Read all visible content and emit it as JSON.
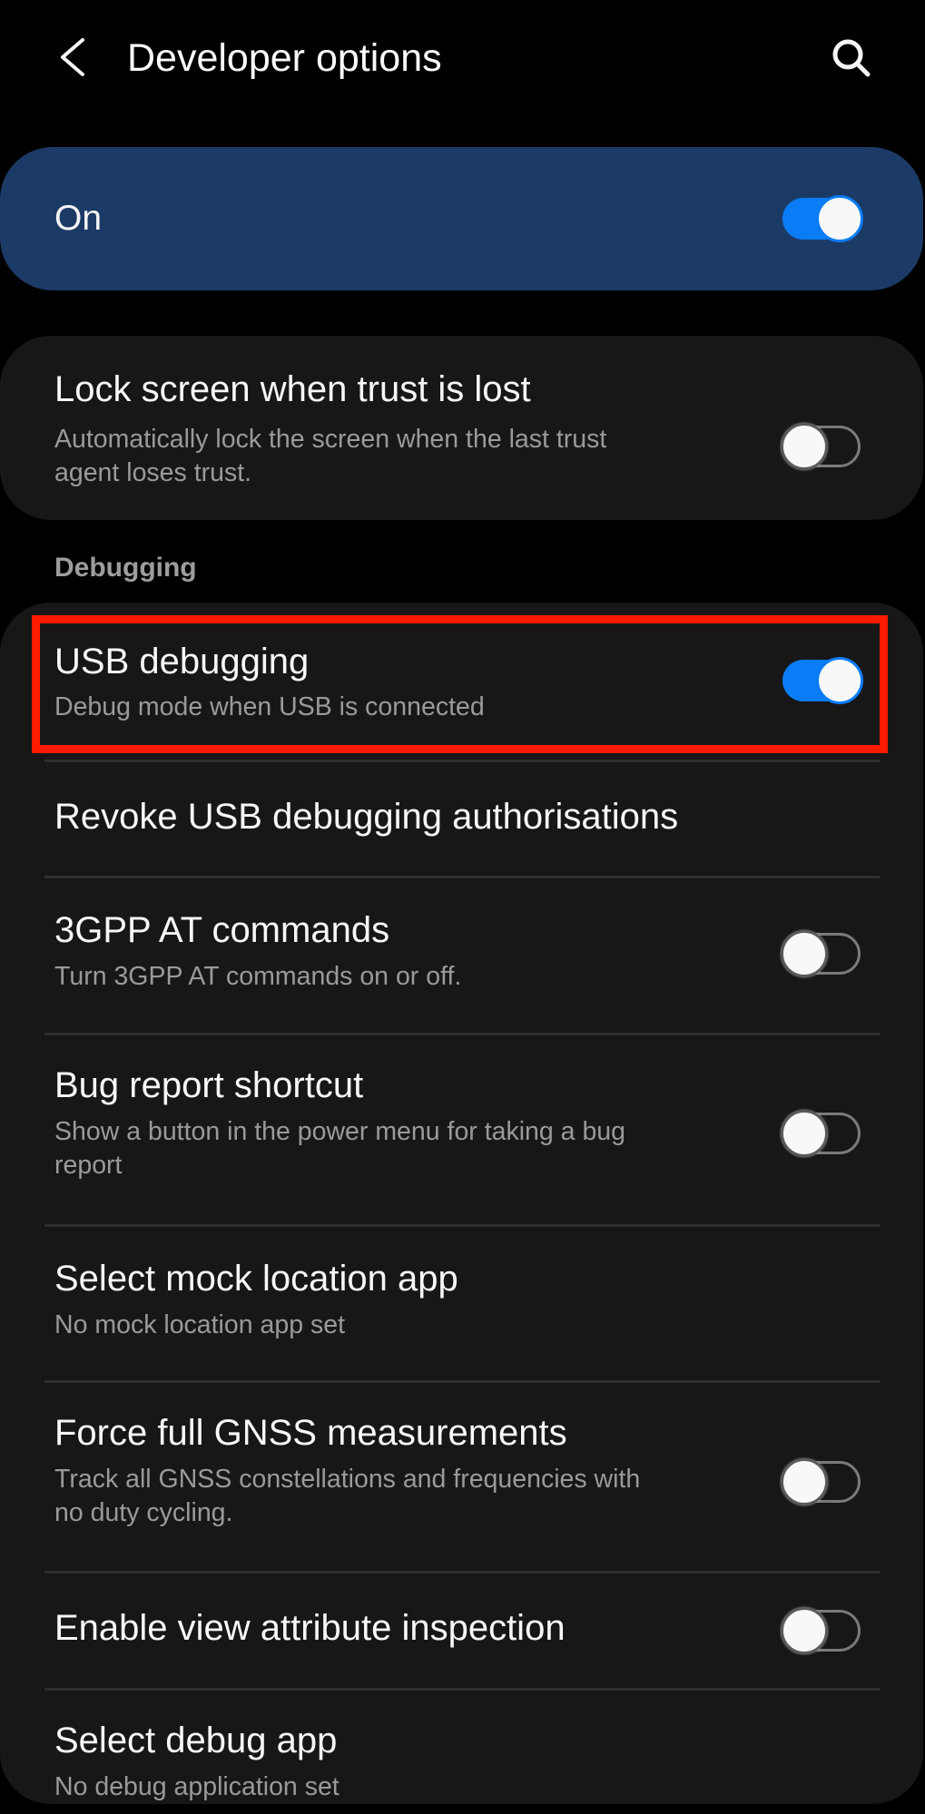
{
  "header": {
    "title": "Developer options",
    "back_icon": "chevron-left-icon",
    "search_icon": "search-icon"
  },
  "master_switch": {
    "label": "On",
    "checked": true
  },
  "lock_screen": {
    "title": "Lock screen when trust is lost",
    "subtitle_line1": "Automatically lock the screen when the last trust",
    "subtitle_line2": "agent loses trust.",
    "checked": false
  },
  "section": {
    "debugging": "Debugging"
  },
  "debug_items": [
    {
      "title": "USB debugging",
      "subtitle": "Debug mode when USB is connected",
      "toggle": true,
      "checked": true,
      "highlighted": true
    },
    {
      "title": "Revoke USB debugging authorisations"
    },
    {
      "title": "3GPP AT commands",
      "subtitle": "Turn 3GPP AT commands on or off.",
      "toggle": true,
      "checked": false
    },
    {
      "title": "Bug report shortcut",
      "subtitle_line1": "Show a button in the power menu for taking a bug",
      "subtitle_line2": "report",
      "toggle": true,
      "checked": false
    },
    {
      "title": "Select mock location app",
      "subtitle": "No mock location app set"
    },
    {
      "title": "Force full GNSS measurements",
      "subtitle_line1": "Track all GNSS constellations and frequencies with",
      "subtitle_line2": "no duty cycling.",
      "toggle": true,
      "checked": false
    },
    {
      "title": "Enable view attribute inspection",
      "toggle": true,
      "checked": false
    },
    {
      "title": "Select debug app",
      "subtitle": "No debug application set"
    }
  ],
  "colors": {
    "background": "#000000",
    "master_card": "#1c3a66",
    "card": "#171717",
    "accent": "#0a7cf5",
    "highlight": "#ff1a00",
    "subtitle": "#9a9a9a"
  }
}
